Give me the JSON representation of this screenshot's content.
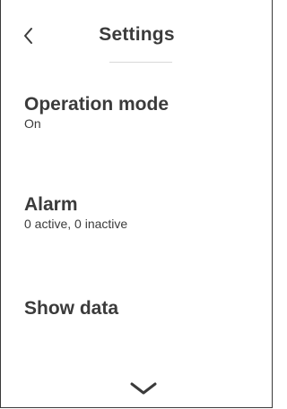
{
  "header": {
    "title": "Settings"
  },
  "icons": {
    "back": "chevron-left-icon",
    "more": "chevron-down-icon"
  },
  "items": [
    {
      "title": "Operation mode",
      "subtitle": "On"
    },
    {
      "title": "Alarm",
      "subtitle": "0 active, 0 inactive"
    },
    {
      "title": "Show data",
      "subtitle": ""
    }
  ],
  "colors": {
    "text": "#3b3b3b",
    "divider": "#d9d9d9",
    "background": "#ffffff"
  }
}
